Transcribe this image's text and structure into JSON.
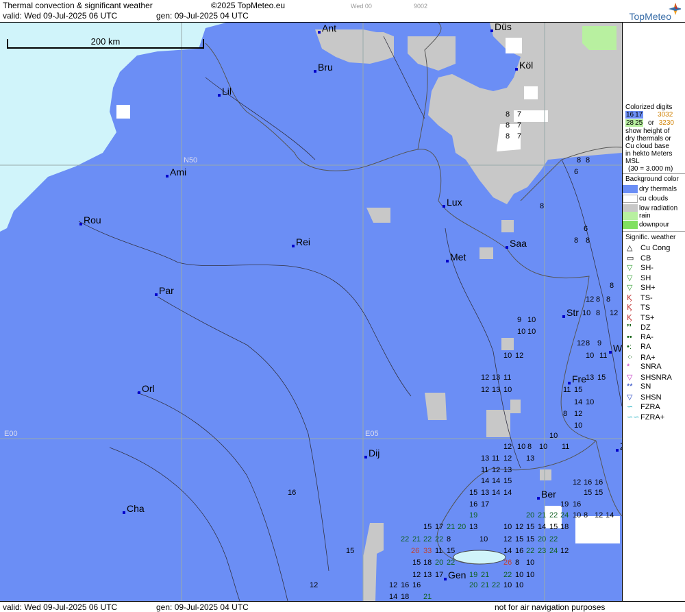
{
  "header": {
    "title": "Thermal convection & significant weather",
    "copyright": "©2025 TopMeteo.eu",
    "slot_day": "Wed 00",
    "slot_code": "9002",
    "valid": "valid:  Wed  09-Jul-2025  06 UTC",
    "generated": "gen: 09-Jul-2025 04 UTC",
    "logo": "TopMeteo"
  },
  "scale_label": "200 km",
  "grid_labels": {
    "n50": "N50",
    "e00": "E00",
    "e05": "E05"
  },
  "cities": [
    "Ant",
    "Düs",
    "Bru",
    "Köl",
    "Lil",
    "Ami",
    "Lux",
    "Rou",
    "Rei",
    "Saa",
    "Met",
    "Par",
    "Str",
    "W",
    "Fre",
    "Orl",
    "Dij",
    "Ber",
    "Cha",
    "Gen",
    "Z"
  ],
  "values": [
    "8",
    "7",
    "8",
    "7",
    "8",
    "7",
    "8",
    "8",
    "6",
    "8",
    "8",
    "6",
    "8",
    "8",
    "8",
    "8",
    "12",
    "12",
    "10",
    "8",
    "9",
    "10",
    "10",
    "10",
    "12",
    "8",
    "9",
    "10",
    "12",
    "10",
    "11",
    "12",
    "13",
    "11",
    "12",
    "13",
    "10",
    "13",
    "15",
    "15",
    "11",
    "14",
    "10",
    "8",
    "12",
    "10",
    "10",
    "10",
    "8",
    "10",
    "11",
    "12",
    "13",
    "11",
    "12",
    "13",
    "11",
    "12",
    "13",
    "14",
    "14",
    "15",
    "15",
    "13",
    "14",
    "14",
    "12",
    "16",
    "16",
    "15",
    "15",
    "16",
    "17",
    "19",
    "16",
    "19",
    "20",
    "21",
    "22",
    "24",
    "10",
    "8",
    "12",
    "14",
    "16",
    "15",
    "15",
    "17",
    "21",
    "20",
    "13",
    "10",
    "12",
    "15",
    "14",
    "15",
    "18",
    "21",
    "22",
    "22",
    "8",
    "10",
    "12",
    "15",
    "15",
    "20",
    "22",
    "22",
    "26",
    "33",
    "11",
    "15",
    "14",
    "16",
    "22",
    "23",
    "24",
    "12",
    "15",
    "18",
    "20",
    "22",
    "26",
    "8",
    "10",
    "12",
    "13",
    "17",
    "19",
    "21",
    "22",
    "10",
    "10",
    "12",
    "16",
    "16",
    "20",
    "21",
    "22",
    "10",
    "10",
    "12",
    "14",
    "18",
    "21"
  ],
  "legend": {
    "colorized_title": "Colorized digits",
    "sample1a": "16",
    "sample1b": "17",
    "or": "or",
    "sample2a": "30",
    "sample2b": "32",
    "sample3a": "28",
    "sample3b": "25",
    "sample4a": "32",
    "sample4b": "30",
    "desc1": "show height of",
    "desc2": "dry thermals or",
    "desc3": "Cu cloud base",
    "desc4": "in hekto Meters",
    "desc5": "MSL",
    "desc6": "(30 = 3.000 m)",
    "bg_title": "Background color",
    "bg_items": [
      "dry thermals",
      "cu clouds",
      "low radiation",
      "rain",
      "downpour"
    ],
    "wx_title": "Signific. weather",
    "wx_items": [
      "Cu Cong",
      "CB",
      "SH-",
      "SH",
      "SH+",
      "TS-",
      "TS",
      "TS+",
      "DZ",
      "RA-",
      "RA",
      "RA+",
      "SNRA",
      "SHSNRA",
      "SN",
      "SHSN",
      "FZRA",
      "FZRA+"
    ]
  },
  "footer": {
    "valid": "valid:  Wed  09-Jul-2025  06 UTC",
    "generated": "gen: 09-Jul-2025 04 UTC",
    "disclaimer": "not for air navigation purposes"
  },
  "colors": {
    "dry_thermals": "#6b8ef5",
    "cu_clouds": "#ffffff",
    "low_radiation": "#c8c8c8",
    "rain": "#b8f0a0",
    "downpour": "#80e060",
    "sea": "#d0f4fa"
  }
}
